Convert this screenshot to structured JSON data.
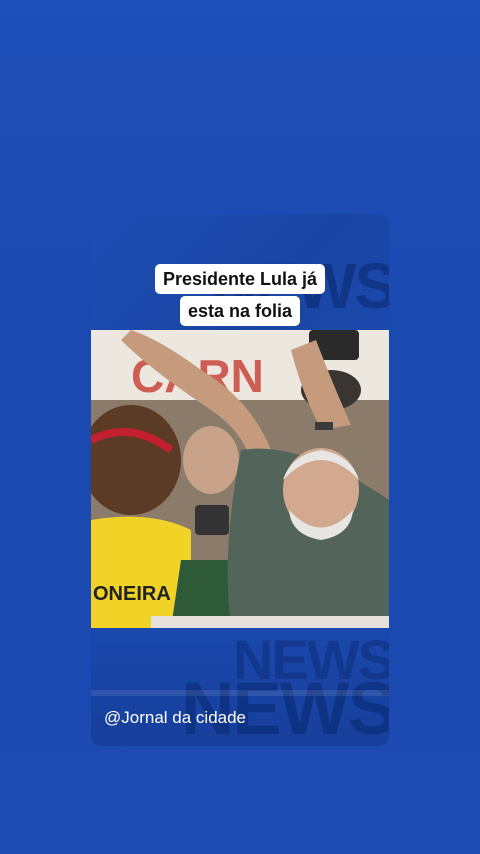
{
  "caption": {
    "line1": "Presidente Lula já",
    "line2": "esta na folia"
  },
  "photo": {
    "banner_text": "CARN",
    "shirt_text": "ONEIRA"
  },
  "watermark": {
    "top": "NEWS",
    "bottom1": "NEWS",
    "bottom2": "NEWS"
  },
  "footer": {
    "handle": "@Jornal da cidade"
  },
  "colors": {
    "background": "#1f4fb8",
    "card": "#1b49ad",
    "caption_bg": "#ffffff",
    "caption_text": "#111111"
  }
}
